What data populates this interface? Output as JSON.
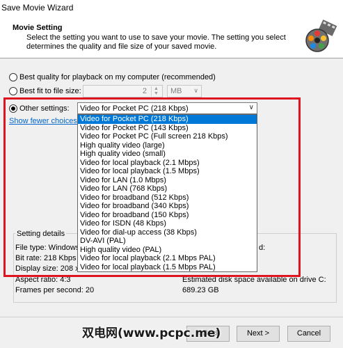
{
  "window": {
    "title": "Save Movie Wizard"
  },
  "header": {
    "title": "Movie Setting",
    "description": "Select the setting you want to use to save your movie. The setting you select determines the quality and file size of your saved movie."
  },
  "options": {
    "best_quality": "Best quality for playback on my computer (recommended)",
    "best_fit": "Best fit to file size:",
    "best_fit_value": "2",
    "best_fit_unit": "MB",
    "other": "Other settings:",
    "other_value": "Video for Pocket PC (218 Kbps)",
    "show_fewer": "Show fewer choices..."
  },
  "dropdown_items": [
    "Video for Pocket PC (218 Kbps)",
    "Video for Pocket PC (143 Kbps)",
    "Video for Pocket PC (Full screen 218 Kbps)",
    "High quality video (large)",
    "High quality video (small)",
    "Video for local playback (2.1 Mbps)",
    "Video for local playback (1.5 Mbps)",
    "Video for LAN (1.0 Mbps)",
    "Video for LAN (768 Kbps)",
    "Video for broadband (512 Kbps)",
    "Video for broadband (340 Kbps)",
    "Video for broadband (150 Kbps)",
    "Video for ISDN (48 Kbps)",
    "Video for dial-up access (38 Kbps)",
    "DV-AVI (PAL)",
    "High quality video (PAL)",
    "Video for local playback (2.1 Mbps PAL)",
    "Video for local playback (1.5 Mbps PAL)"
  ],
  "details": {
    "label": "Setting details",
    "file_type": "File type: Windows",
    "bit_rate": "Bit rate: 218 Kbps",
    "display_size": "Display size: 208 x",
    "aspect_ratio": "Aspect ratio: 4:3",
    "frames": "Frames per second: 20",
    "right_partial": "d:",
    "disk_space_label": "Estimated disk space available on drive C:",
    "disk_space_value": "689.23 GB"
  },
  "buttons": {
    "next": "Next >",
    "back": "< Back",
    "cancel": "Cancel"
  },
  "watermark": "双电网(www.pcpc.me)"
}
